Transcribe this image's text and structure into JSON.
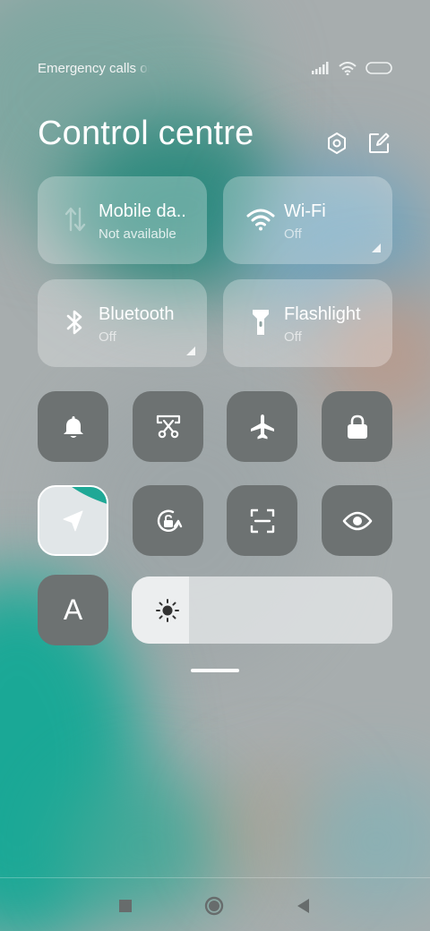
{
  "status_bar": {
    "carrier_text": "Emergency calls only",
    "icons": [
      "signal-icon",
      "wifi-icon",
      "battery-icon"
    ]
  },
  "header": {
    "title": "Control centre",
    "icons": [
      "settings-icon",
      "edit-icon"
    ]
  },
  "tiles": [
    {
      "id": "mobile-data",
      "label": "Mobile da..",
      "status": "Not available",
      "icon": "mobile-data-icon"
    },
    {
      "id": "wifi",
      "label": "Wi-Fi",
      "status": "Off",
      "icon": "wifi-icon"
    },
    {
      "id": "bluetooth",
      "label": "Bluetooth",
      "status": "Off",
      "icon": "bluetooth-icon"
    },
    {
      "id": "flashlight",
      "label": "Flashlight",
      "status": "Off",
      "icon": "flashlight-icon"
    }
  ],
  "toggles": [
    {
      "id": "sound",
      "icon": "bell-icon",
      "active": false
    },
    {
      "id": "screenshot",
      "icon": "scissors-icon",
      "active": false
    },
    {
      "id": "airplane-mode",
      "icon": "airplane-icon",
      "active": false
    },
    {
      "id": "lock-screen",
      "icon": "lock-icon",
      "active": false
    },
    {
      "id": "location",
      "icon": "location-arrow-icon",
      "active": true
    },
    {
      "id": "rotation-lock",
      "icon": "rotation-lock-icon",
      "active": false
    },
    {
      "id": "scanner",
      "icon": "scan-frame-icon",
      "active": false
    },
    {
      "id": "reading-mode",
      "icon": "eye-icon",
      "active": false
    },
    {
      "id": "font-size",
      "icon": "font-icon",
      "label": "A",
      "active": false
    }
  ],
  "brightness": {
    "icon": "brightness-sun-icon",
    "level": 0.22
  },
  "colors": {
    "accent": "#1fa896",
    "tile_dark": "#6d7272",
    "active_tile": "#e1e6e8"
  },
  "nav": [
    "recents-button",
    "home-button",
    "back-button"
  ]
}
